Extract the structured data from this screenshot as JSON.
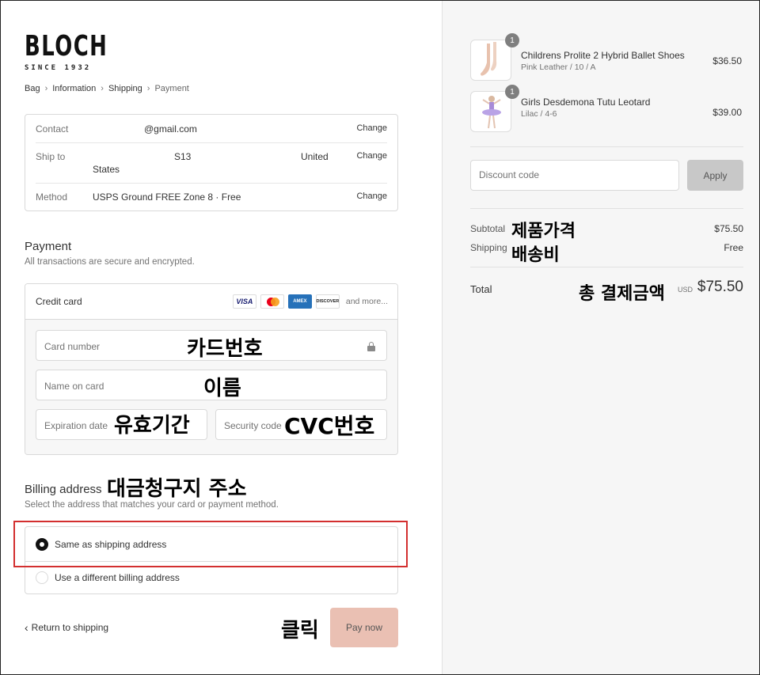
{
  "brand": {
    "name": "BLOCH",
    "tagline": "SINCE 1932"
  },
  "breadcrumb": [
    "Bag",
    "Information",
    "Shipping",
    "Payment"
  ],
  "review": {
    "contact_label": "Contact",
    "contact_value": "@gmail.com",
    "shipto_label": "Ship to",
    "shipto_part1": "S13",
    "shipto_part2": "United",
    "shipto_part3": "States",
    "method_label": "Method",
    "method_value": "USPS Ground FREE Zone 8 · Free",
    "change_label": "Change"
  },
  "payment": {
    "title": "Payment",
    "subtitle": "All transactions are secure and encrypted.",
    "method_label": "Credit card",
    "brands": [
      "VISA",
      "mastercard",
      "AMEX",
      "DISCOVER"
    ],
    "and_more": "and more...",
    "card_number_placeholder": "Card number",
    "name_placeholder": "Name on card",
    "expiry_placeholder": "Expiration date",
    "security_placeholder": "Security code"
  },
  "billing": {
    "title": "Billing address",
    "subtitle": "Select the address that matches your card or payment method.",
    "option_same": "Same as shipping address",
    "option_different": "Use a different billing address",
    "selected": "same"
  },
  "footer": {
    "return_label": "Return to shipping",
    "pay_label": "Pay now"
  },
  "annotations": {
    "card_number": "카드번호",
    "name": "이름",
    "expiry": "유효기간",
    "cvc": "CVC번호",
    "billing": "대금청구지 주소",
    "click": "클릭",
    "subtotal": "제품가격",
    "shipping": "배송비",
    "total": "총 결제금액"
  },
  "cart": {
    "items": [
      {
        "name": "Childrens Prolite 2 Hybrid Ballet Shoes",
        "variant": "Pink Leather / 10 / A",
        "price": "$36.50",
        "qty": "1"
      },
      {
        "name": "Girls Desdemona Tutu Leotard",
        "variant": "Lilac / 4-6",
        "price": "$39.00",
        "qty": "1"
      }
    ],
    "discount_placeholder": "Discount code",
    "apply_label": "Apply",
    "subtotal_label": "Subtotal",
    "subtotal_value": "$75.50",
    "shipping_label": "Shipping",
    "shipping_value": "Free",
    "total_label": "Total",
    "currency": "USD",
    "total_value": "$75.50"
  },
  "colors": {
    "pay_button": "#eac0b3",
    "highlight": "#d32f2f",
    "apply_button": "#c8c8c8"
  }
}
